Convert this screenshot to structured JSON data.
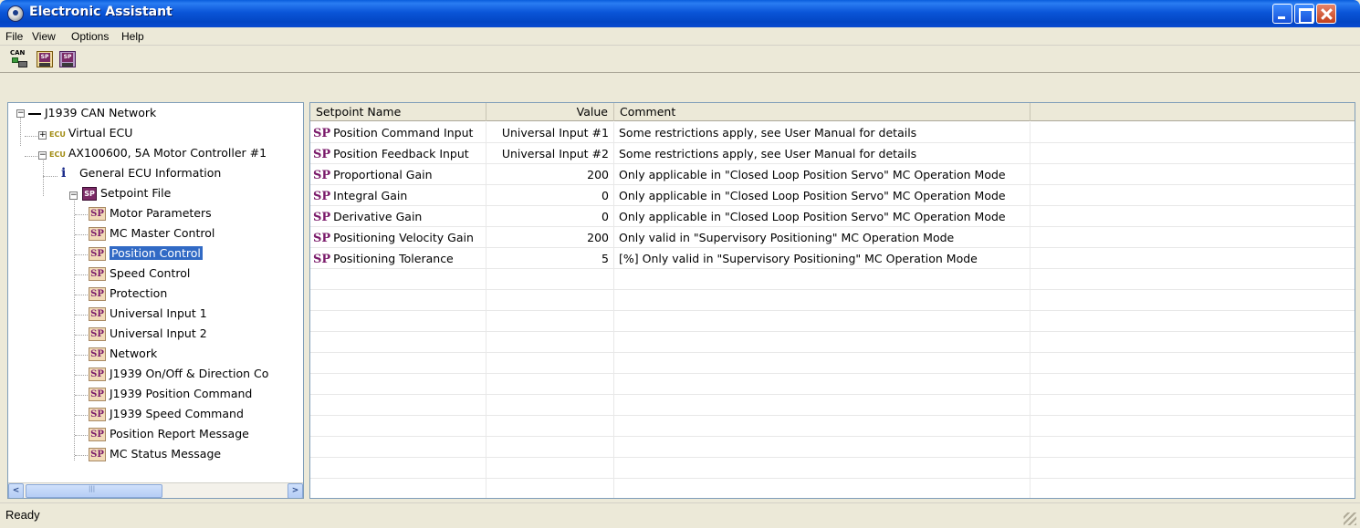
{
  "window": {
    "title": "Electronic Assistant"
  },
  "menu": [
    "File",
    "View",
    "Options",
    "Help"
  ],
  "toolbar": {
    "can_label": "CAN",
    "sp_label": "SP"
  },
  "tree": {
    "root": "J1939 CAN Network",
    "ecu_tag": "ECU",
    "virtual_ecu": "Virtual ECU",
    "controller": "AX100600, 5A Motor Controller #1",
    "general": "General ECU Information",
    "setpoint_file": "Setpoint File",
    "sp_tag": "SP",
    "items": [
      "Motor Parameters",
      "MC Master Control",
      "Position Control",
      "Speed Control",
      "Protection",
      "Universal Input 1",
      "Universal Input 2",
      "Network",
      "J1939 On/Off & Direction Co",
      "J1939 Position Command",
      "J1939 Speed Command",
      "Position Report Message",
      "MC Status Message"
    ],
    "selected": "Position Control"
  },
  "grid": {
    "columns": [
      "Setpoint Name",
      "Value",
      "Comment"
    ],
    "rows": [
      {
        "name": "Position Command Input",
        "value": "Universal Input #1",
        "comment": "Some restrictions apply, see User Manual for details"
      },
      {
        "name": "Position Feedback Input",
        "value": "Universal Input #2",
        "comment": "Some restrictions apply, see User Manual for details"
      },
      {
        "name": "Proportional Gain",
        "value": "200",
        "comment": "Only applicable in \"Closed Loop Position Servo\" MC Operation Mode"
      },
      {
        "name": "Integral Gain",
        "value": "0",
        "comment": "Only applicable in \"Closed Loop Position Servo\" MC Operation Mode"
      },
      {
        "name": "Derivative Gain",
        "value": "0",
        "comment": "Only applicable in \"Closed Loop Position Servo\" MC Operation Mode"
      },
      {
        "name": "Positioning Velocity Gain",
        "value": "200",
        "comment": "Only valid in \"Supervisory Positioning\" MC Operation Mode"
      },
      {
        "name": "Positioning Tolerance",
        "value": "5",
        "comment": "[%] Only valid in \"Supervisory Positioning\" MC Operation Mode"
      }
    ],
    "empty_rows": 11
  },
  "status": {
    "text": "Ready"
  },
  "colors": {
    "title_blue": "#0a55d8",
    "sp_purple": "#7a1a6a",
    "selection": "#316ac5"
  }
}
